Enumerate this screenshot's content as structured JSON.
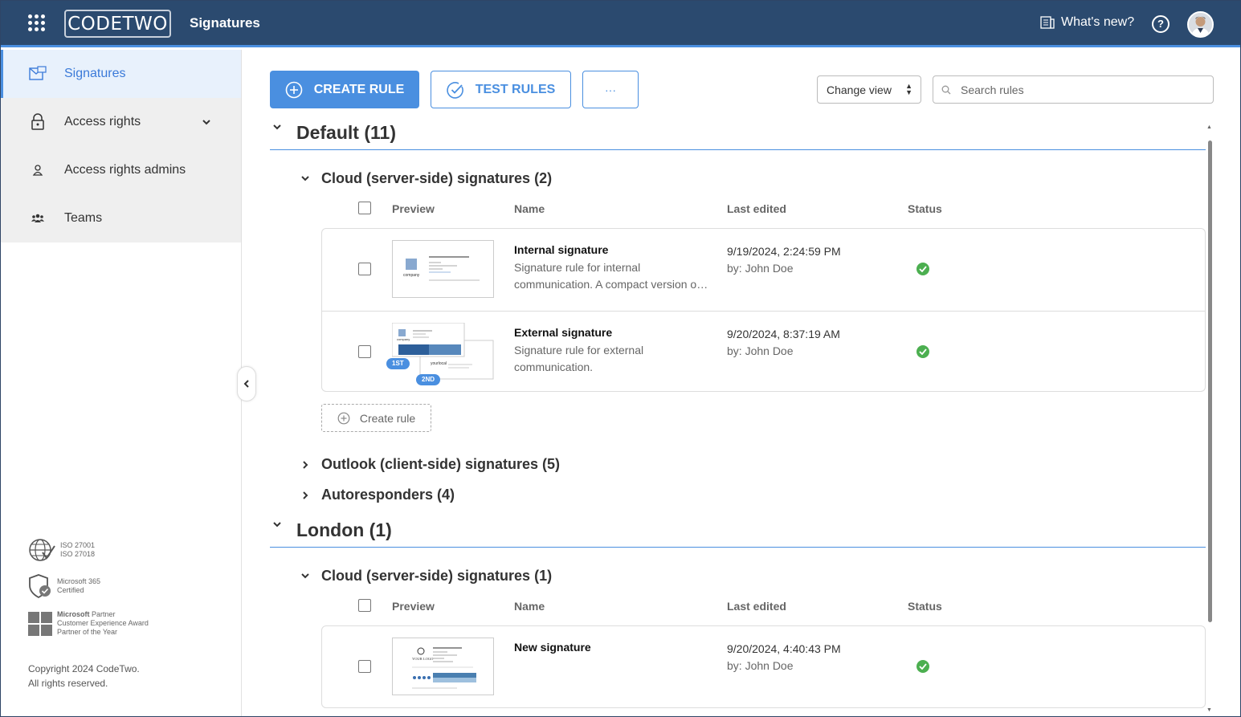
{
  "topbar": {
    "logo_text": "CODETWO",
    "app_title": "Signatures",
    "whats_new": "What's new?",
    "help": "?"
  },
  "sidebar": {
    "items": [
      {
        "label": "Signatures",
        "icon": "signatures-icon",
        "active": true
      },
      {
        "label": "Access rights",
        "icon": "lock-icon",
        "expandable": true
      },
      {
        "label": "Access rights admins",
        "icon": "person-icon"
      },
      {
        "label": "Teams",
        "icon": "team-icon"
      }
    ],
    "certs": {
      "iso_line1": "ISO 27001",
      "iso_line2": "ISO 27018",
      "ms365_line1": "Microsoft 365",
      "ms365_line2": "Certified",
      "partner_brand": "Microsoft",
      "partner_word": "Partner",
      "partner_line2": "Customer Experience Award",
      "partner_line3": "Partner of the Year"
    },
    "copyright_line1": "Copyright 2024 CodeTwo.",
    "copyright_line2": "All rights reserved."
  },
  "toolbar": {
    "create_rule": "CREATE RULE",
    "test_rules": "TEST RULES",
    "more": "···",
    "change_view": "Change view",
    "search_placeholder": "Search rules"
  },
  "columns": {
    "preview": "Preview",
    "name": "Name",
    "last_edited": "Last edited",
    "status": "Status"
  },
  "groups": [
    {
      "title": "Default (11)",
      "subgroups": [
        {
          "title": "Cloud (server-side) signatures (2)",
          "expanded": true,
          "rules": [
            {
              "name": "Internal signature",
              "desc": "Signature rule for internal communication. A compact version o…",
              "date": "9/19/2024, 2:24:59 PM",
              "by": "by: John Doe",
              "status": "active"
            },
            {
              "name": "External signature",
              "desc": "Signature rule for external communication.",
              "date": "9/20/2024, 8:37:19 AM",
              "by": "by: John Doe",
              "status": "active",
              "badges": [
                "1ST",
                "2ND"
              ]
            }
          ],
          "create_rule": "Create rule"
        },
        {
          "title": "Outlook (client-side) signatures (5)",
          "expanded": false
        },
        {
          "title": "Autoresponders (4)",
          "expanded": false
        }
      ]
    },
    {
      "title": "London (1)",
      "subgroups": [
        {
          "title": "Cloud (server-side) signatures (1)",
          "expanded": true,
          "rules": [
            {
              "name": "New signature",
              "desc": "",
              "date": "9/20/2024, 4:40:43 PM",
              "by": "by: John Doe",
              "status": "active"
            }
          ]
        }
      ]
    }
  ],
  "colors": {
    "topbar": "#2b4a6f",
    "accent": "#4a8fe0",
    "status_ok": "#4caf50"
  }
}
